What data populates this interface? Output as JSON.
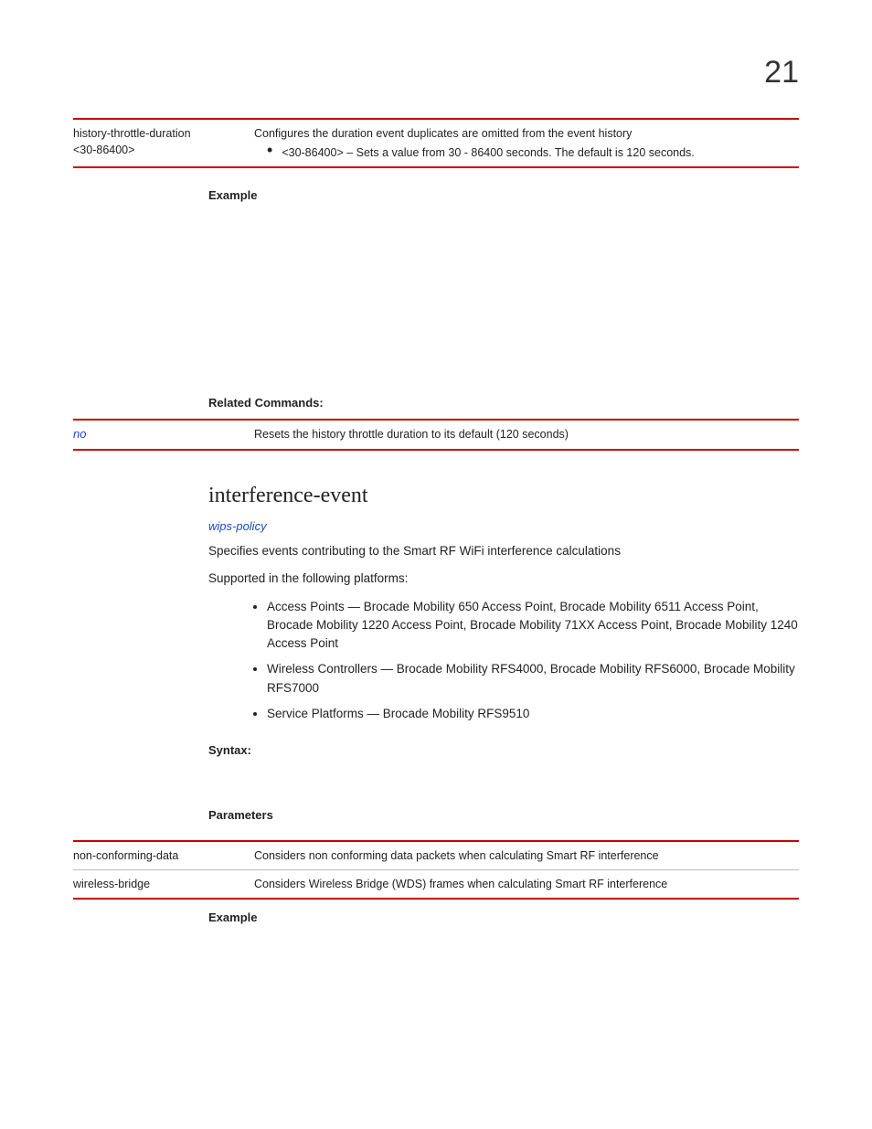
{
  "page_number": "21",
  "table1": {
    "key_line1": "history-throttle-duration",
    "key_line2": "<30-86400>",
    "desc_line1": "Configures the duration event duplicates are omitted from the event history",
    "desc_bullet": "<30-86400> – Sets a value from 30 - 86400 seconds. The default is 120 seconds."
  },
  "label_example": "Example",
  "label_related": "Related Commands:",
  "table2": {
    "key": "no",
    "desc": "Resets the history throttle duration to its default (120 seconds)"
  },
  "section_title": "interference-event",
  "context_link": "wips-policy",
  "intro_p": "Specifies events contributing to the Smart RF WiFi interference calculations",
  "supported_p": "Supported in the following platforms:",
  "platforms": {
    "ap": "Access Points — Brocade Mobility 650 Access Point, Brocade Mobility 6511 Access Point, Brocade Mobility 1220 Access Point, Brocade Mobility 71XX Access Point, Brocade Mobility 1240 Access Point",
    "wc": "Wireless Controllers — Brocade Mobility RFS4000, Brocade Mobility RFS6000, Brocade Mobility RFS7000",
    "sp": "Service Platforms — Brocade Mobility RFS9510"
  },
  "label_syntax": "Syntax:",
  "label_params": "Parameters",
  "table3": {
    "row1_key": "non-conforming-data",
    "row1_desc": "Considers non conforming data packets when calculating Smart RF interference",
    "row2_key": "wireless-bridge",
    "row2_desc": "Considers Wireless Bridge (WDS) frames when calculating Smart RF interference"
  },
  "label_example2": "Example"
}
